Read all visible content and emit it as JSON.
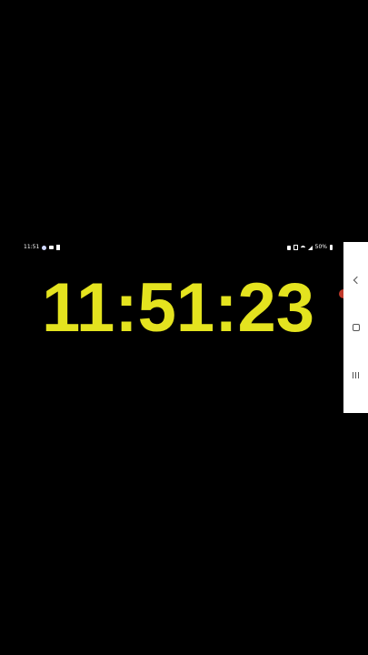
{
  "status_bar": {
    "time": "11:51",
    "battery_percent": "50%",
    "left_icons": [
      "messenger-icon",
      "camera-icon",
      "sim-card-icon"
    ],
    "right_icons": [
      "lock-icon",
      "vibrate-icon",
      "wifi-icon",
      "signal-icon",
      "battery-icon"
    ]
  },
  "clock": {
    "time": "11:51:23",
    "color": "#e4e31f"
  },
  "nav_bar": {
    "buttons": [
      "back",
      "home",
      "recents"
    ],
    "background": "#ffffff"
  },
  "colors": {
    "background": "#000000",
    "edge_dot": "#c0392b"
  }
}
